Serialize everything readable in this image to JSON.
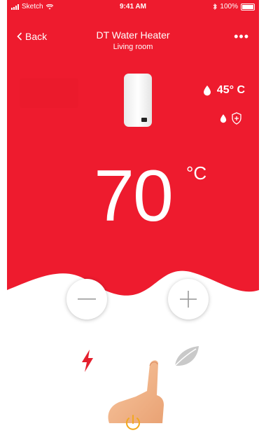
{
  "status_bar": {
    "carrier": "Sketch",
    "time": "9:41 AM",
    "battery": "100%"
  },
  "nav": {
    "back_label": "Back",
    "title": "DT Water Heater",
    "subtitle": "Living room",
    "more_label": "•••"
  },
  "sensor": {
    "water_temp": "45° C"
  },
  "target": {
    "value": "70",
    "unit": "°C"
  },
  "colors": {
    "brand_red": "#ee1b2e",
    "power_orange": "#f2a81d"
  },
  "icons": {
    "back": "chevron-left-icon",
    "more": "more-dots-icon",
    "heater": "water-heater-icon",
    "drop": "water-drop-icon",
    "shield": "shield-plus-icon",
    "minus": "minus-icon",
    "plus": "plus-icon",
    "bolt": "lightning-bolt-icon",
    "hand": "pointing-hand-icon",
    "leaf": "eco-leaf-icon",
    "power": "power-icon"
  }
}
